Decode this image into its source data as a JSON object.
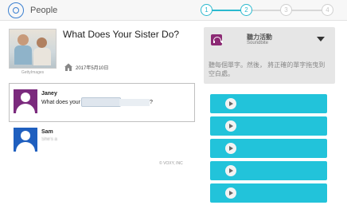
{
  "header": {
    "app_title": "People",
    "logo_icon": "voxy-people-logo",
    "steps": [
      "1",
      "2",
      "3",
      "4"
    ],
    "current_step": 2,
    "accent_color": "#2bb9cf"
  },
  "lesson": {
    "title": "What Does Your Sister Do?",
    "date": "2017年5月10日",
    "image_credit": "GettyImages",
    "home_icon": "house-icon"
  },
  "dialogue": {
    "lines": [
      {
        "speaker": "Janey",
        "text_before": "What does your",
        "text_after": "?",
        "avatar_color": "#7b2a7d"
      },
      {
        "speaker": "Sam",
        "text": "She's a",
        "avatar_color": "#1f5fbf"
      }
    ]
  },
  "footer": {
    "copyright": "© VOXY, INC"
  },
  "activity": {
    "name": "聽力活動",
    "subtitle": "Soundbite",
    "instructions": "聽每個單字。然後，  將正確的單字拖曳到空白處。",
    "icon": "headphones-icon",
    "icon_color": "#8c2a74"
  },
  "audio_choices": [
    {
      "icon": "play-icon"
    },
    {
      "icon": "play-icon"
    },
    {
      "icon": "play-icon"
    },
    {
      "icon": "play-icon"
    },
    {
      "icon": "play-icon"
    }
  ]
}
